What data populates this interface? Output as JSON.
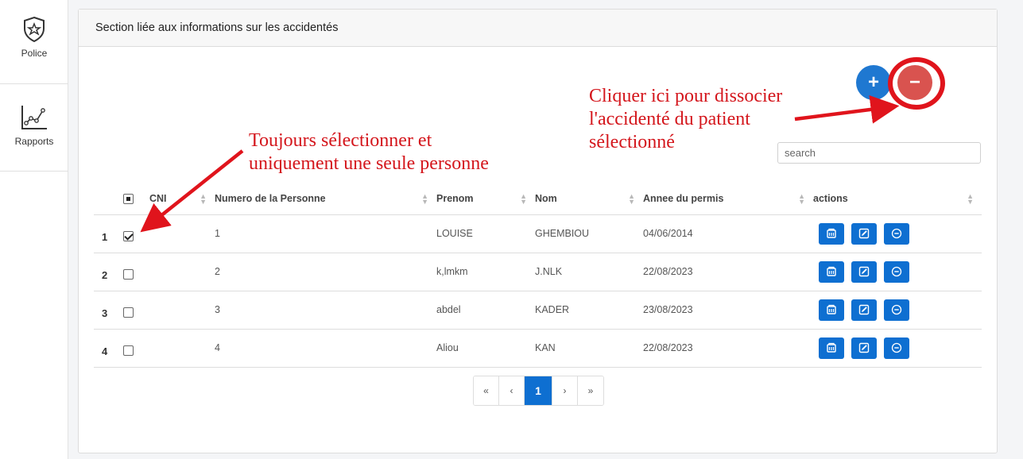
{
  "sidebar": {
    "items": [
      {
        "label": "Police",
        "icon": "police-badge-icon"
      },
      {
        "label": "Rapports",
        "icon": "chart-line-icon"
      }
    ]
  },
  "card": {
    "title": "Section liée aux informations sur les accidentés"
  },
  "toolbar": {
    "add_label": "+",
    "remove_label": "−"
  },
  "search": {
    "placeholder": "search",
    "value": ""
  },
  "table": {
    "columns": [
      "CNI",
      "Numero de la Personne",
      "Prenom",
      "Nom",
      "Annee du permis",
      "actions"
    ],
    "rows": [
      {
        "index": "1",
        "checked": true,
        "cni": "",
        "numero": "1",
        "prenom": "LOUISE",
        "nom": "GHEMBIOU",
        "annee": "04/06/2014"
      },
      {
        "index": "2",
        "checked": false,
        "cni": "",
        "numero": "2",
        "prenom": "k,lmkm",
        "nom": "J.NLK",
        "annee": "22/08/2023"
      },
      {
        "index": "3",
        "checked": false,
        "cni": "",
        "numero": "3",
        "prenom": "abdel",
        "nom": "KADER",
        "annee": "23/08/2023"
      },
      {
        "index": "4",
        "checked": false,
        "cni": "",
        "numero": "4",
        "prenom": "Aliou",
        "nom": "KAN",
        "annee": "22/08/2023"
      }
    ]
  },
  "pagination": {
    "first": "«",
    "prev": "‹",
    "current": "1",
    "next": "›",
    "last": "»"
  },
  "annotations": {
    "left_line1": "Toujours sélectionner et",
    "left_line2": "uniquement une seule personne",
    "right_line1": "Cliquer ici pour dissocier",
    "right_line2": "l'accidenté du patient",
    "right_line3": "sélectionné"
  },
  "colors": {
    "primary": "#0e6fd1",
    "danger": "#d9534f",
    "annotation": "#d4161c"
  }
}
